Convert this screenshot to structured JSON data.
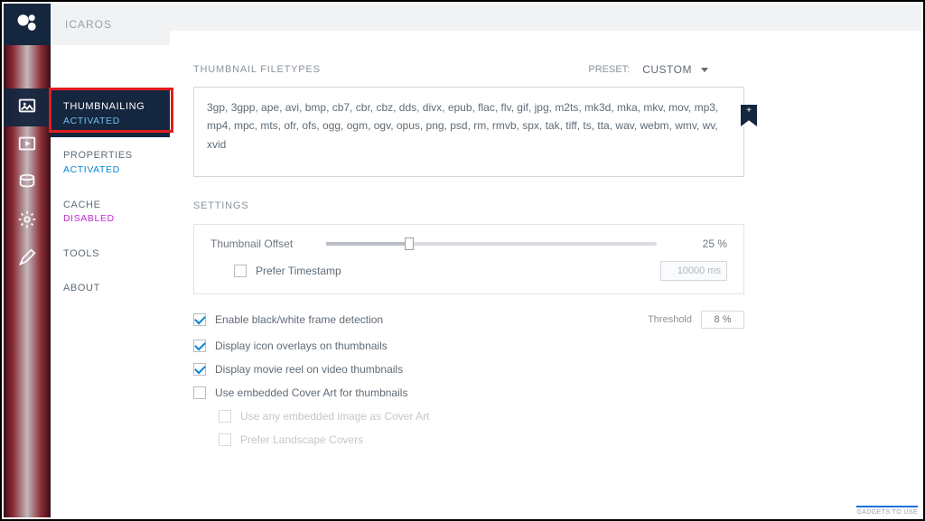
{
  "app": {
    "name": "ICAROS"
  },
  "rail": {
    "items": [
      {
        "id": "thumbnailing",
        "active": true
      },
      {
        "id": "properties"
      },
      {
        "id": "cache"
      },
      {
        "id": "tools"
      },
      {
        "id": "about"
      }
    ]
  },
  "sidebar": {
    "items": [
      {
        "title": "THUMBNAILING",
        "status": "ACTIVATED",
        "status_class": "activated",
        "active": true
      },
      {
        "title": "PROPERTIES",
        "status": "ACTIVATED",
        "status_class": "activated"
      },
      {
        "title": "CACHE",
        "status": "DISABLED",
        "status_class": "disabled"
      },
      {
        "title": "TOOLS",
        "status": ""
      },
      {
        "title": "ABOUT",
        "status": ""
      }
    ]
  },
  "filetypes": {
    "heading": "THUMBNAIL FILETYPES",
    "preset_label": "PRESET:",
    "preset_value": "CUSTOM",
    "list": "3gp, 3gpp, ape, avi, bmp, cb7, cbr, cbz, dds, divx, epub, flac, flv, gif, jpg, m2ts, mk3d, mka, mkv, mov, mp3, mp4, mpc, mts, ofr, ofs, ogg, ogm, ogv, opus, png, psd, rm, rmvb, spx, tak, tiff, ts, tta, wav, webm, wmv, wv, xvid",
    "bookmark_glyph": "+"
  },
  "settings": {
    "heading": "SETTINGS",
    "thumbnail_offset_label": "Thumbnail Offset",
    "thumbnail_offset_value": "25 %",
    "prefer_timestamp_label": "Prefer Timestamp",
    "prefer_timestamp_value": "10000 ms",
    "options": [
      {
        "label": "Enable black/white frame detection",
        "checked": true,
        "threshold_label": "Threshold",
        "threshold_value": "8 %"
      },
      {
        "label": "Display icon overlays on thumbnails",
        "checked": true
      },
      {
        "label": "Display movie reel on video thumbnails",
        "checked": true
      },
      {
        "label": "Use embedded Cover Art for thumbnails",
        "checked": false
      }
    ],
    "sub_options": [
      {
        "label": "Use any embedded image as Cover Art"
      },
      {
        "label": "Prefer Landscape Covers"
      }
    ]
  },
  "watermark": "GADGETS TO USE"
}
